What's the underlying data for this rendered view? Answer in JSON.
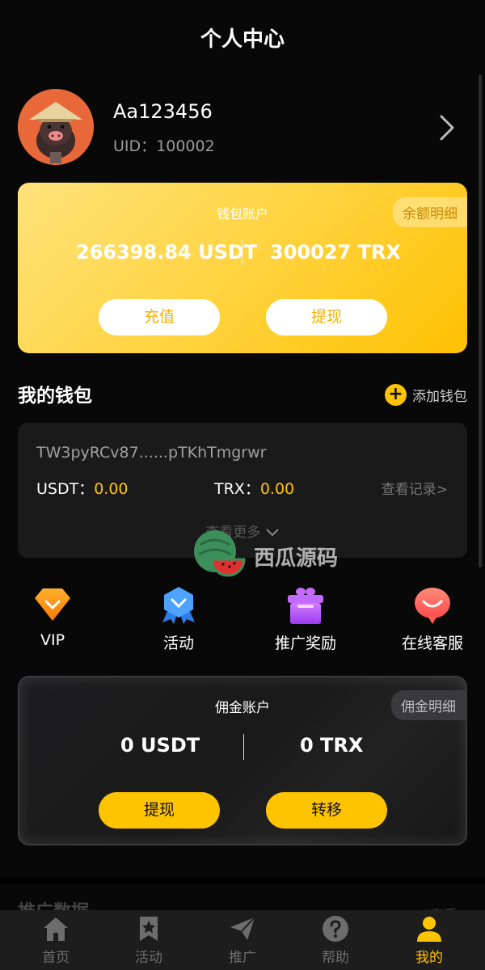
{
  "header": {
    "title": "个人中心"
  },
  "profile": {
    "username": "Aa123456",
    "uid": "UID：100002"
  },
  "wallet_account": {
    "title": "钱包账户",
    "detail_label": "余额明细",
    "usdt_amount": "266398.84 USDT",
    "trx_amount": "300027 TRX",
    "recharge_label": "充值",
    "withdraw_label": "提现",
    "accent_color": "#ffc400"
  },
  "my_wallet": {
    "title": "我的钱包",
    "add_label": "添加钱包",
    "address": "TW3pyRCv87......pTKhTmgrwr",
    "usdt_label": "USDT：",
    "usdt_value": "0.00",
    "trx_label": "TRX：",
    "trx_value": "0.00",
    "records_label": "查看记录>",
    "see_more_label": "查看更多"
  },
  "watermark": {
    "text": "西瓜源码"
  },
  "features": [
    {
      "label": "VIP",
      "icon": "vip-diamond-icon"
    },
    {
      "label": "活动",
      "icon": "activity-badge-icon"
    },
    {
      "label": "推广奖励",
      "icon": "gift-box-icon"
    },
    {
      "label": "在线客服",
      "icon": "chat-bubble-icon"
    }
  ],
  "commission_account": {
    "title": "佣金账户",
    "detail_label": "佣金明细",
    "usdt_amount": "0 USDT",
    "trx_amount": "0 TRX",
    "withdraw_label": "提现",
    "transfer_label": "转移"
  },
  "peek": {
    "left": "推广数据",
    "right": "查看 ›"
  },
  "tabbar": {
    "items": [
      {
        "label": "首页",
        "icon": "home-icon",
        "active": false
      },
      {
        "label": "活动",
        "icon": "star-bookmark-icon",
        "active": false
      },
      {
        "label": "推广",
        "icon": "paper-plane-icon",
        "active": false
      },
      {
        "label": "帮助",
        "icon": "help-question-icon",
        "active": false
      },
      {
        "label": "我的",
        "icon": "user-icon",
        "active": true
      }
    ]
  }
}
